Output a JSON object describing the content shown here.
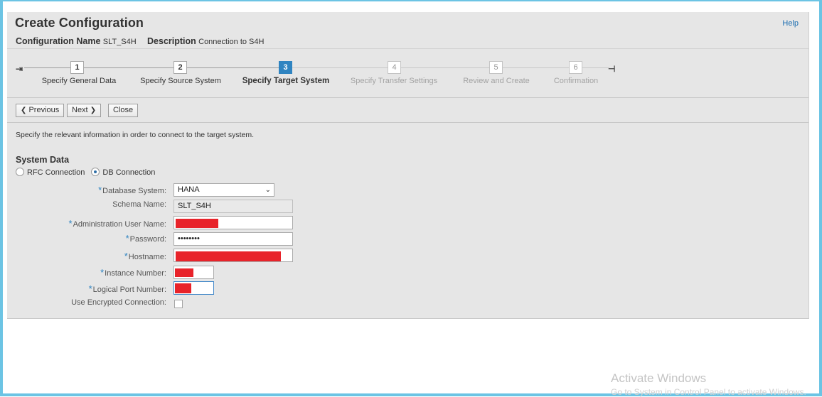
{
  "header": {
    "title": "Create Configuration",
    "help": "Help",
    "config_name_label": "Configuration Name",
    "config_name_value": "SLT_S4H",
    "description_label": "Description",
    "description_value": "Connection to S4H"
  },
  "roadmap": {
    "steps": [
      {
        "number": "1",
        "label": "Specify General Data",
        "state": "done"
      },
      {
        "number": "2",
        "label": "Specify Source System",
        "state": "done"
      },
      {
        "number": "3",
        "label": "Specify Target System",
        "state": "active"
      },
      {
        "number": "4",
        "label": "Specify Transfer Settings",
        "state": "disabled"
      },
      {
        "number": "5",
        "label": "Review and Create",
        "state": "disabled"
      },
      {
        "number": "6",
        "label": "Confirmation",
        "state": "disabled"
      }
    ]
  },
  "toolbar": {
    "previous_label": "Previous",
    "next_label": "Next",
    "close_label": "Close"
  },
  "instruction": "Specify the relevant information in order to connect to the target system.",
  "system_data": {
    "title": "System Data",
    "rfc_label": "RFC Connection",
    "db_label": "DB Connection",
    "selected": "DB Connection"
  },
  "form": {
    "database_system_label": "Database System:",
    "database_system_value": "HANA",
    "schema_name_label": "Schema Name:",
    "schema_name_value": "SLT_S4H",
    "admin_user_label": "Administration User Name:",
    "password_label": "Password:",
    "password_value": "••••••••",
    "hostname_label": "Hostname:",
    "instance_number_label": "Instance Number:",
    "logical_port_label": "Logical Port Number:",
    "encrypted_label": "Use Encrypted Connection:",
    "encrypted_checked": false
  },
  "colors": {
    "accent": "#2f84c1",
    "redaction": "#e8232a",
    "frame": "#6cc4e4"
  },
  "watermark": {
    "line1": "Activate Windows",
    "line2": "Go to System in Control Panel to activate Windows."
  }
}
